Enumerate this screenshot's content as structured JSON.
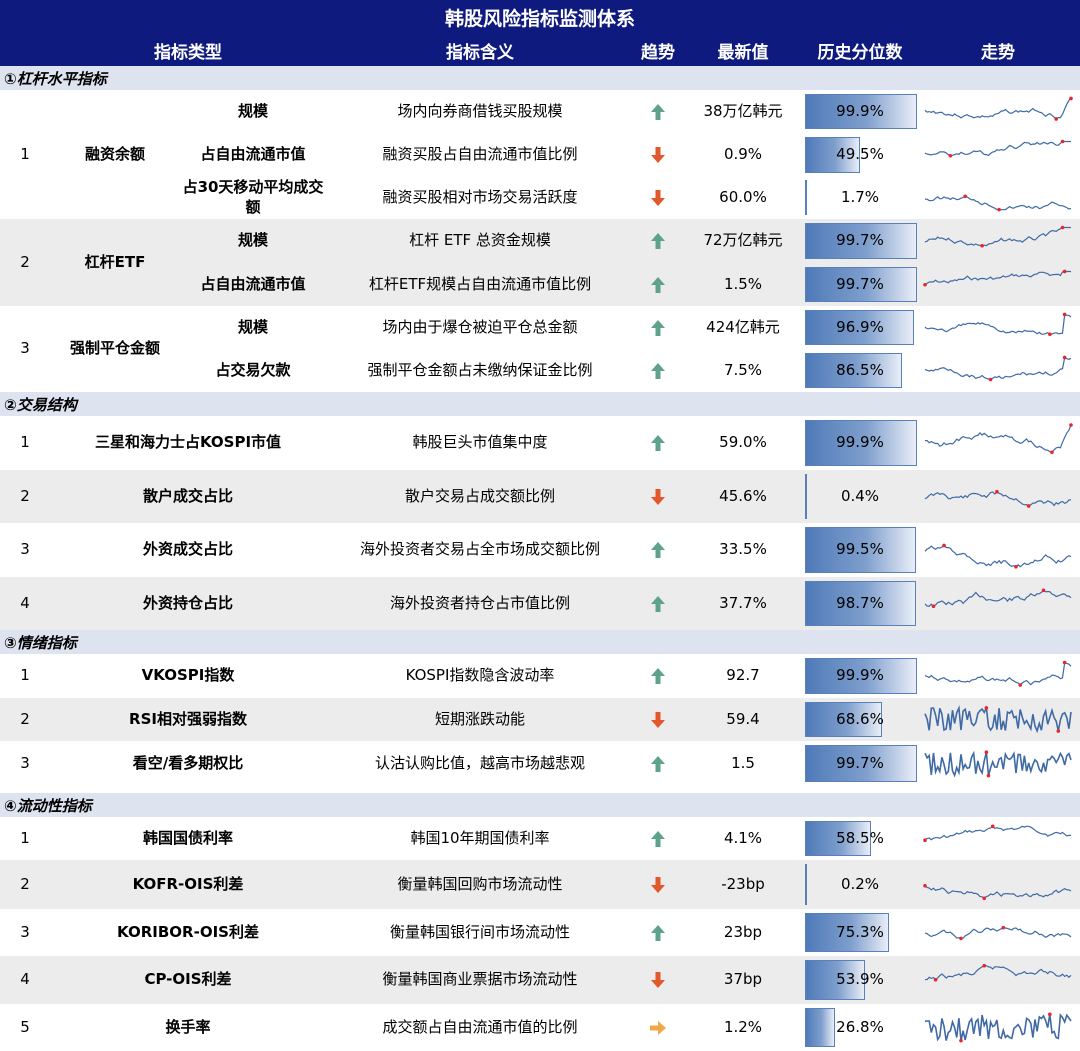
{
  "title": "韩股风险指标监测体系",
  "headers": [
    "指标类型",
    "指标含义",
    "趋势",
    "最新值",
    "历史分位数",
    "走势"
  ],
  "colors": {
    "header_bg": "#0e1a7e",
    "section_bg": "#dde4f0",
    "row_gray": "#ececec",
    "up_arrow": "#5fa28a",
    "down_arrow": "#e2572b",
    "flat_arrow": "#f0a94a",
    "spark_line": "#3f6aa5",
    "spark_marker": "#e8262a"
  },
  "sections": [
    {
      "label": "①杠杆水平指标"
    },
    {
      "label": "②交易结构"
    },
    {
      "label": "③情绪指标"
    },
    {
      "label": "④流动性指标"
    }
  ],
  "groups": [
    {
      "num": "1",
      "type": "融资余额"
    },
    {
      "num": "2",
      "type": "杠杆ETF"
    },
    {
      "num": "3",
      "type": "强制平仓金额"
    }
  ],
  "rows": [
    {
      "sub": "规模",
      "meaning": "场内向券商借钱买股规模",
      "trend": "up",
      "trend_icon": "up-arrow-icon",
      "latest": "38万亿韩元",
      "pct": "99.9%",
      "pct_value": 0.999
    },
    {
      "sub": "占自由流通市值",
      "meaning": "融资买股占自由流通市值比例",
      "trend": "down",
      "trend_icon": "down-arrow-icon",
      "latest": "0.9%",
      "pct": "49.5%",
      "pct_value": 0.495
    },
    {
      "sub": "占30天移动平均成交额",
      "meaning": "融资买股相对市场交易活跃度",
      "trend": "down",
      "trend_icon": "down-arrow-icon",
      "latest": "60.0%",
      "pct": "1.7%",
      "pct_value": 0.017
    },
    {
      "sub": "规模",
      "meaning": "杠杆 ETF 总资金规模",
      "trend": "up",
      "trend_icon": "up-arrow-icon",
      "latest": "72万亿韩元",
      "pct": "99.7%",
      "pct_value": 0.997
    },
    {
      "sub": "占自由流通市值",
      "meaning": "杠杆ETF规模占自由流通市值比例",
      "trend": "up",
      "trend_icon": "up-arrow-icon",
      "latest": "1.5%",
      "pct": "99.7%",
      "pct_value": 0.997
    },
    {
      "sub": "规模",
      "meaning": "场内由于爆仓被迫平仓总金额",
      "trend": "up",
      "trend_icon": "up-arrow-icon",
      "latest": "424亿韩元",
      "pct": "96.9%",
      "pct_value": 0.969
    },
    {
      "sub": "占交易欠款",
      "meaning": "强制平仓金额占未缴纳保证金比例",
      "trend": "up",
      "trend_icon": "up-arrow-icon",
      "latest": "7.5%",
      "pct": "86.5%",
      "pct_value": 0.865
    },
    {
      "num": "1",
      "type": "三星和海力士占KOSPI市值",
      "meaning": "韩股巨头市值集中度",
      "trend": "up",
      "trend_icon": "up-arrow-icon",
      "latest": "59.0%",
      "pct": "99.9%",
      "pct_value": 0.999
    },
    {
      "num": "2",
      "type": "散户成交占比",
      "meaning": "散户交易占成交额比例",
      "trend": "down",
      "trend_icon": "down-arrow-icon",
      "latest": "45.6%",
      "pct": "0.4%",
      "pct_value": 0.004
    },
    {
      "num": "3",
      "type": "外资成交占比",
      "meaning": "海外投资者交易占全市场成交额比例",
      "trend": "up",
      "trend_icon": "up-arrow-icon",
      "latest": "33.5%",
      "pct": "99.5%",
      "pct_value": 0.995
    },
    {
      "num": "4",
      "type": "外资持仓占比",
      "meaning": "海外投资者持仓占市值比例",
      "trend": "up",
      "trend_icon": "up-arrow-icon",
      "latest": "37.7%",
      "pct": "98.7%",
      "pct_value": 0.987
    },
    {
      "num": "1",
      "type": "VKOSPI指数",
      "meaning": "KOSPI指数隐含波动率",
      "trend": "up",
      "trend_icon": "up-arrow-icon",
      "latest": "92.7",
      "pct": "99.9%",
      "pct_value": 0.999
    },
    {
      "num": "2",
      "type": "RSI相对强弱指数",
      "meaning": "短期涨跌动能",
      "trend": "down",
      "trend_icon": "down-arrow-icon",
      "latest": "59.4",
      "pct": "68.6%",
      "pct_value": 0.686
    },
    {
      "num": "3",
      "type": "看空/看多期权比",
      "meaning": "认沽认购比值，越高市场越悲观",
      "trend": "up",
      "trend_icon": "up-arrow-icon",
      "latest": "1.5",
      "pct": "99.7%",
      "pct_value": 0.997
    },
    {
      "num": "1",
      "type": "韩国国债利率",
      "meaning": "韩国10年期国债利率",
      "trend": "up",
      "trend_icon": "up-arrow-icon",
      "latest": "4.1%",
      "pct": "58.5%",
      "pct_value": 0.585
    },
    {
      "num": "2",
      "type": "KOFR-OIS利差",
      "meaning": "衡量韩国回购市场流动性",
      "trend": "down",
      "trend_icon": "down-arrow-icon",
      "latest": "-23bp",
      "pct": "0.2%",
      "pct_value": 0.002
    },
    {
      "num": "3",
      "type": "KORIBOR-OIS利差",
      "meaning": "衡量韩国银行间市场流动性",
      "trend": "up",
      "trend_icon": "up-arrow-icon",
      "latest": "23bp",
      "pct": "75.3%",
      "pct_value": 0.753
    },
    {
      "num": "4",
      "type": "CP-OIS利差",
      "meaning": "衡量韩国商业票据市场流动性",
      "trend": "down",
      "trend_icon": "down-arrow-icon",
      "latest": "37bp",
      "pct": "53.9%",
      "pct_value": 0.539
    },
    {
      "num": "5",
      "type": "换手率",
      "meaning": "成交额占自由流通市值的比例",
      "trend": "flat",
      "trend_icon": "right-arrow-icon",
      "latest": "1.2%",
      "pct": "26.8%",
      "pct_value": 0.268
    }
  ]
}
